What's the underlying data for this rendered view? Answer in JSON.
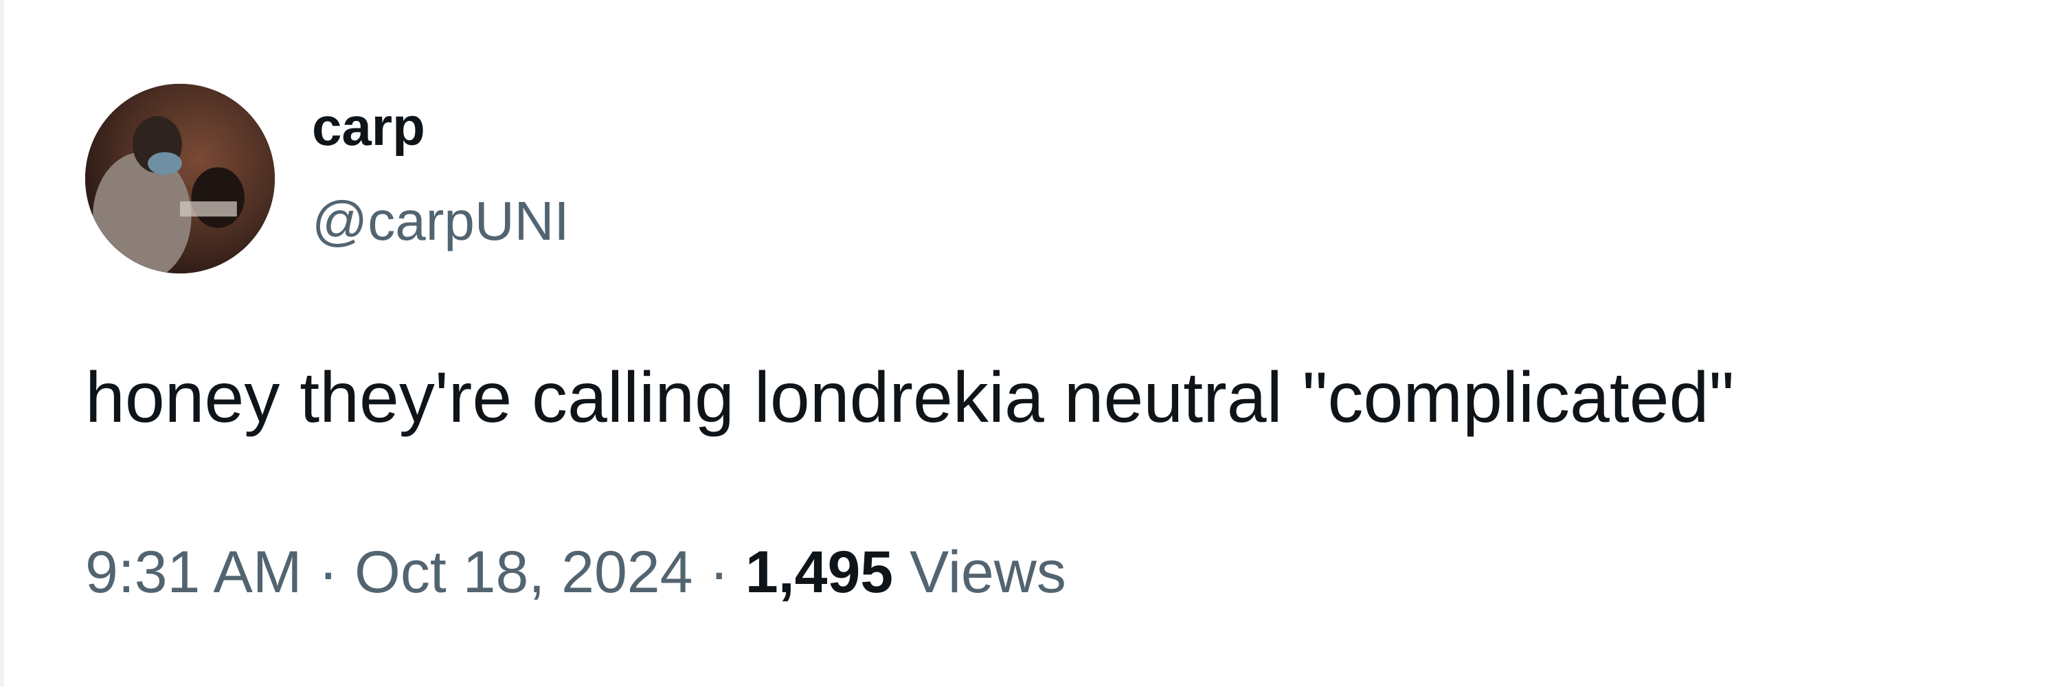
{
  "tweet": {
    "author": {
      "display_name": "carp",
      "handle": "@carpUNI"
    },
    "text": "honey they're calling londrekia neutral \"complicated\"",
    "meta": {
      "time": "9:31 AM",
      "separator": "·",
      "date": "Oct 18, 2024",
      "views_count": "1,495",
      "views_label": "Views"
    }
  }
}
